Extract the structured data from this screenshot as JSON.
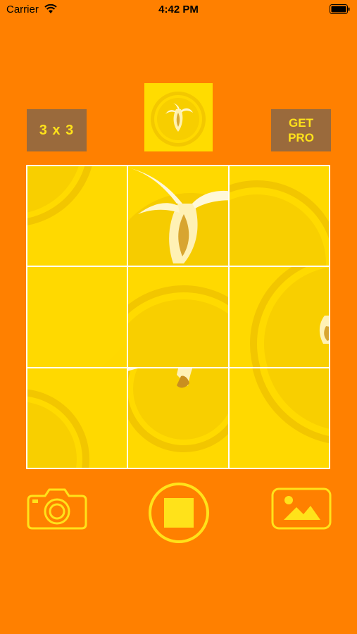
{
  "status_bar": {
    "carrier": "Carrier",
    "time": "4:42 PM"
  },
  "header": {
    "grid_size_label": "3 x 3",
    "get_pro_line1": "GET",
    "get_pro_line2": "PRO"
  },
  "puzzle": {
    "grid": "3 x 3",
    "tile_count": 9
  },
  "toolbar": {
    "camera_icon": "camera-icon",
    "shutter_icon": "shutter-stop-icon",
    "gallery_icon": "photo-gallery-icon"
  },
  "colors": {
    "background": "#FF8000",
    "accent_yellow": "#FFE21A",
    "button_brown": "#9A6A3C",
    "board_yellow": "#FFD800"
  }
}
